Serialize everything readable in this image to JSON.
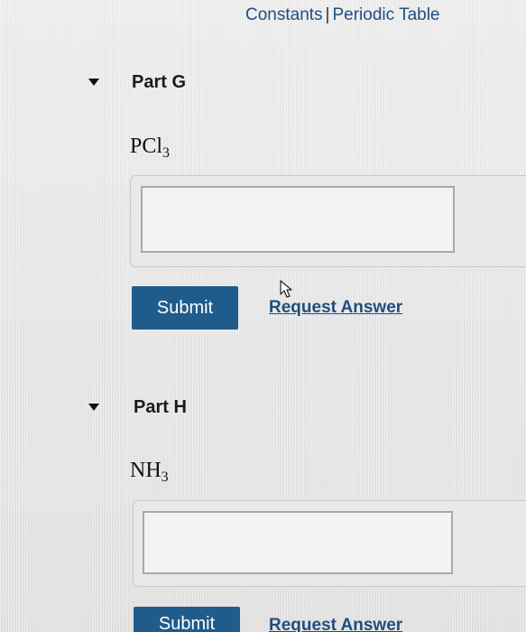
{
  "header": {
    "constants_label": "Constants",
    "separator": "|",
    "periodic_table_label": "Periodic Table"
  },
  "parts": [
    {
      "title": "Part G",
      "formula_base": "PCl",
      "formula_sub": "3",
      "answer_value": "",
      "submit_label": "Submit",
      "request_label": "Request Answer"
    },
    {
      "title": "Part H",
      "formula_base": "NH",
      "formula_sub": "3",
      "answer_value": "",
      "submit_label": "Submit",
      "request_label": "Request Answer"
    }
  ],
  "colors": {
    "link": "#1f4f7f",
    "submit_button": "#1f5c8c"
  },
  "icons": {
    "collapse_caret": "caret-down-icon",
    "pointer": "mouse-cursor-icon"
  }
}
